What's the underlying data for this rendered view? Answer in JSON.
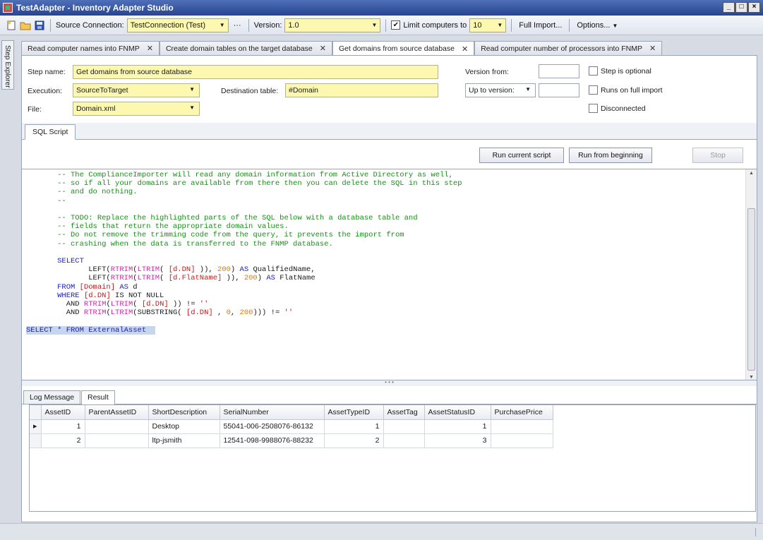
{
  "window": {
    "title": "TestAdapter - Inventory Adapter Studio",
    "min": "_",
    "max": "□",
    "close": "×"
  },
  "toolbar": {
    "source_connection_label": "Source Connection:",
    "source_connection_value": "TestConnection (Test)",
    "more_label": "···",
    "version_label": "Version:",
    "version_value": "1.0",
    "limit_label": "Limit computers to",
    "limit_checked": true,
    "limit_value": "10",
    "full_import_label": "Full Import...",
    "options_label": "Options..."
  },
  "sidebar": {
    "step_explorer_label": "Step Explorer"
  },
  "tabs": [
    {
      "label": "Read computer names into FNMP",
      "active": false
    },
    {
      "label": "Create domain tables on the target database",
      "active": false
    },
    {
      "label": "Get domains from source database",
      "active": true
    },
    {
      "label": "Read computer number of processors into FNMP",
      "active": false
    }
  ],
  "form": {
    "step_name_label": "Step name:",
    "step_name_value": "Get domains from source database",
    "execution_label": "Execution:",
    "execution_value": "SourceToTarget",
    "destination_label": "Destination table:",
    "destination_value": "#Domain",
    "file_label": "File:",
    "file_value": "Domain.xml",
    "version_from_label": "Version from:",
    "version_from_value": "",
    "up_to_version_label": "Up to version:",
    "up_to_version_value": "",
    "step_optional_label": "Step is optional",
    "runs_full_import_label": "Runs on full import",
    "disconnected_label": "Disconnected"
  },
  "script": {
    "tab_label": "SQL Script",
    "run_current_label": "Run current script",
    "run_beginning_label": "Run from beginning",
    "stop_label": "Stop"
  },
  "result": {
    "tabs": [
      "Log Message",
      "Result"
    ],
    "active_tab": "Result",
    "columns": [
      "AssetID",
      "ParentAssetID",
      "ShortDescription",
      "SerialNumber",
      "AssetTypeID",
      "AssetTag",
      "AssetStatusID",
      "PurchasePrice"
    ],
    "rows": [
      [
        "1",
        "",
        "Desktop",
        "55041-006-2508076-86132",
        "1",
        "",
        "1",
        ""
      ],
      [
        "2",
        "",
        "ltp-jsmith",
        "12541-098-9988076-88232",
        "2",
        "",
        "3",
        ""
      ]
    ]
  }
}
